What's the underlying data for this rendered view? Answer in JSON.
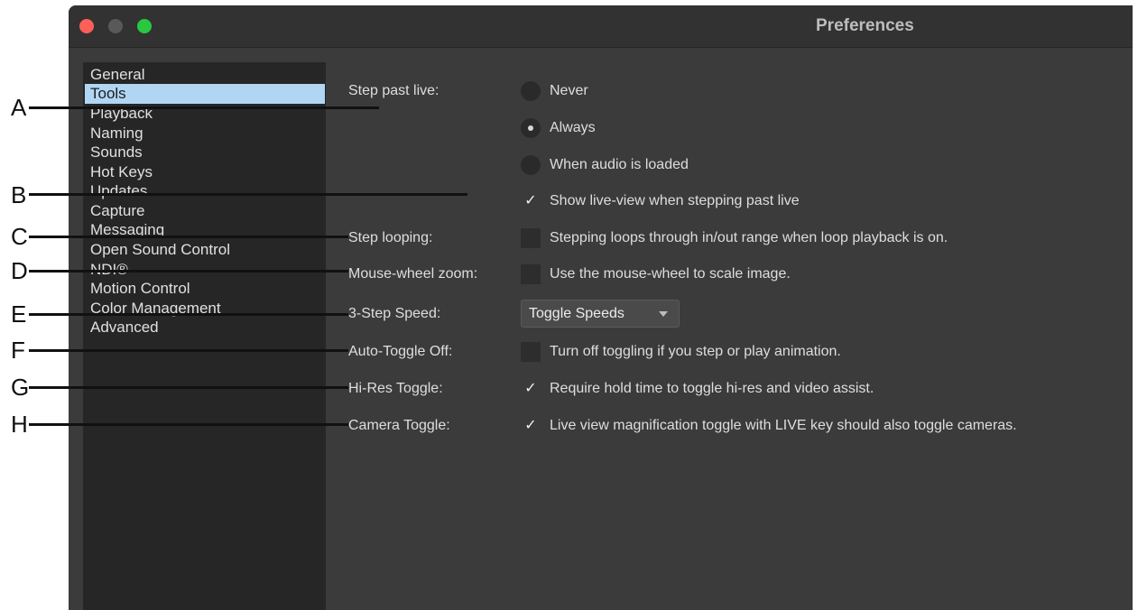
{
  "window": {
    "title": "Preferences"
  },
  "sidebar": {
    "items": [
      {
        "label": "General",
        "selected": false
      },
      {
        "label": "Tools",
        "selected": true
      },
      {
        "label": "Playback",
        "selected": false
      },
      {
        "label": "Naming",
        "selected": false
      },
      {
        "label": "Sounds",
        "selected": false
      },
      {
        "label": "Hot Keys",
        "selected": false
      },
      {
        "label": "Updates",
        "selected": false
      },
      {
        "label": "Capture",
        "selected": false
      },
      {
        "label": "Messaging",
        "selected": false
      },
      {
        "label": "Open Sound Control",
        "selected": false
      },
      {
        "label": "NDI®",
        "selected": false
      },
      {
        "label": "Motion Control",
        "selected": false
      },
      {
        "label": "Color Management",
        "selected": false
      },
      {
        "label": "Advanced",
        "selected": false
      }
    ]
  },
  "settings": {
    "step_past_live": {
      "label": "Step past live:",
      "options": [
        {
          "label": "Never",
          "checked": false
        },
        {
          "label": "Always",
          "checked": true
        },
        {
          "label": "When audio is loaded",
          "checked": false
        }
      ],
      "show_live_view": {
        "label": "Show live-view when stepping past live",
        "checked": true
      }
    },
    "step_looping": {
      "label": "Step looping:",
      "text": "Stepping loops through in/out range when loop playback is on.",
      "checked": false
    },
    "mouse_wheel_zoom": {
      "label": "Mouse-wheel zoom:",
      "text": "Use the mouse-wheel to scale image.",
      "checked": false
    },
    "three_step_speed": {
      "label": "3-Step Speed:",
      "value": "Toggle Speeds"
    },
    "auto_toggle_off": {
      "label": "Auto-Toggle Off:",
      "text": "Turn off toggling if you step or play animation.",
      "checked": false
    },
    "hi_res_toggle": {
      "label": "Hi-Res Toggle:",
      "text": "Require hold time to toggle hi-res and video assist.",
      "checked": true
    },
    "camera_toggle": {
      "label": "Camera Toggle:",
      "text": "Live view magnification toggle with LIVE key should also toggle cameras.",
      "checked": true
    }
  },
  "check_glyph": "✓",
  "callouts": [
    "A",
    "B",
    "C",
    "D",
    "E",
    "F",
    "G",
    "H"
  ],
  "colors": {
    "selection": "#b1d6f4",
    "window_bg": "#3b3b3b",
    "sidebar_bg": "#262626"
  }
}
